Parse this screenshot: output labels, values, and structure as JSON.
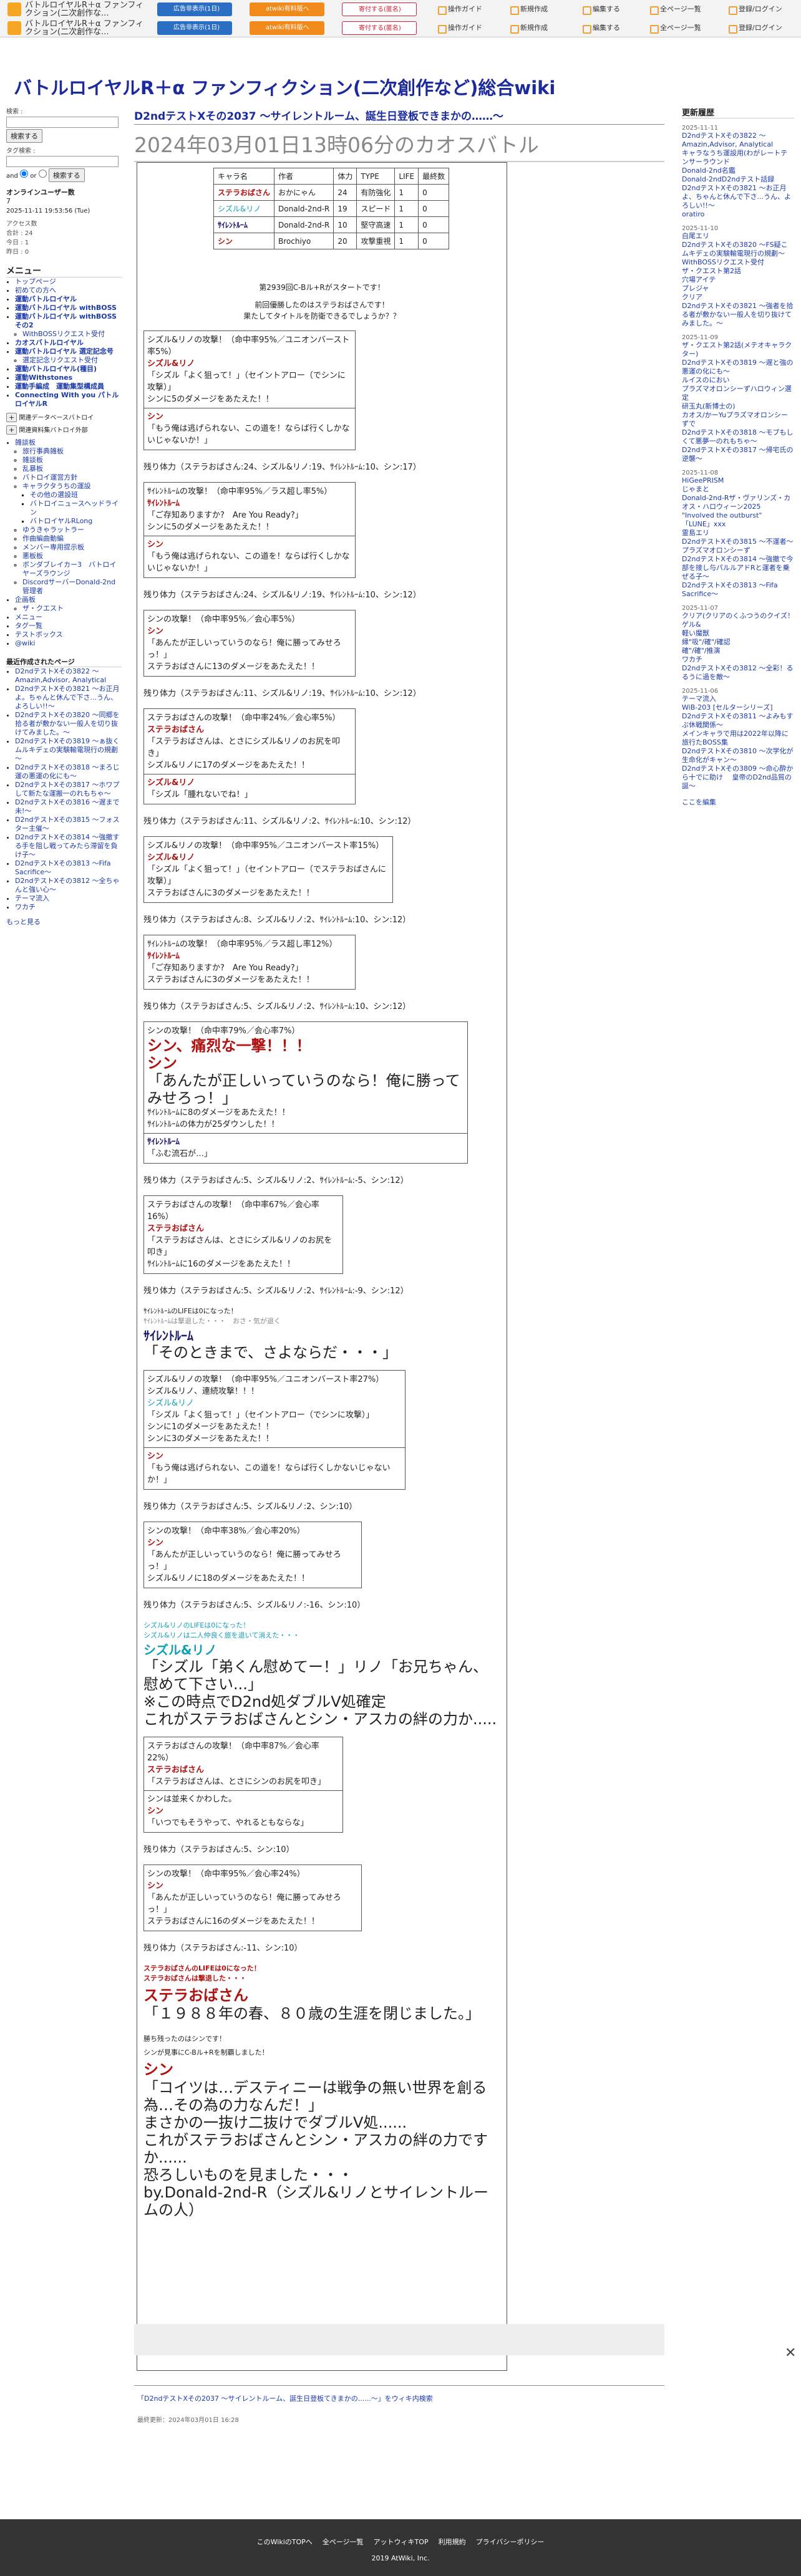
{
  "topbar": {
    "title": "バトルロイヤルR＋α ファンフィクション(二次創作な...",
    "ad_btn": "広告非表示(1日)",
    "pro_btn": "atwiki有料版へ",
    "support_btn": "寄付する(匿名)",
    "links": [
      "操作ガイド",
      "新規作成",
      "編集する",
      "全ページ一覧",
      "登録/ログイン"
    ]
  },
  "site_title": "バトルロイヤルR＋α ファンフィクション(二次創作など)総合wiki",
  "sidebar": {
    "search_label": "検索 :",
    "search_btn": "検索する",
    "tag_label": "タグ検索 :",
    "and_label": "and",
    "or_label": "or",
    "search_btn2": "検索する",
    "online_label": "オンラインユーザー数",
    "online_count": "7",
    "date": "2025-11-11 19:53:56 (Tue)",
    "access_label": "アクセス数",
    "access_total": "合計 : 24",
    "access_today": "今日 : 1",
    "access_yesterday": "昨日 : 0",
    "menu_h": "メニュー",
    "menu": [
      {
        "t": "トップページ",
        "c": ""
      },
      {
        "t": "初めての方へ",
        "c": ""
      },
      {
        "t": "運動バトルロイヤル",
        "c": "b"
      },
      {
        "t": "運動バトルロイヤル withBOSS",
        "c": "b"
      },
      {
        "t": "運動バトルロイヤル withBOSSその2",
        "c": "b"
      },
      {
        "t": "WithBOSSリクエスト受付",
        "c": "s"
      },
      {
        "t": "カオスバトルロイヤル",
        "c": "b"
      },
      {
        "t": "運動バトルロイヤル 選定記念号",
        "c": "b"
      },
      {
        "t": "選定記念リクエスト受付",
        "c": "s"
      },
      {
        "t": "運動バトルロイヤル(種目)",
        "c": "b"
      },
      {
        "t": "運動Withstones",
        "c": "b"
      },
      {
        "t": "運動手編成　運動集型構成員",
        "c": "b"
      },
      {
        "t": "Connecting With you パトルロイヤルR",
        "c": "b"
      }
    ],
    "collapse": "関連データベースバトロイ",
    "collapse2": "関連資料集バトロイ外部",
    "tree": [
      {
        "t": "雑談板",
        "c": ""
      },
      {
        "t": "旅行事典雑板",
        "c": "s"
      },
      {
        "t": "雑談板",
        "c": "s"
      },
      {
        "t": "乱暴板",
        "c": "s"
      },
      {
        "t": "バトロイ運営方針",
        "c": "s"
      },
      {
        "t": "キャラクタうちの運設",
        "c": "s"
      },
      {
        "t": "その他の選設班",
        "c": "s2"
      },
      {
        "t": "バトロイニュースヘッドライン",
        "c": "s2"
      },
      {
        "t": "バトロイヤルRLong",
        "c": "s2"
      },
      {
        "t": "ゆうきゃラットラー",
        "c": "s"
      },
      {
        "t": "作曲編曲動編",
        "c": "s"
      },
      {
        "t": "メンバー専用提示板",
        "c": "s"
      },
      {
        "t": "悪板板",
        "c": "s"
      },
      {
        "t": "ボンダブレイカー3　バトロイヤーズラウンジ",
        "c": "s"
      },
      {
        "t": "DiscordサーバーDonald-2nd管理者",
        "c": "s"
      },
      {
        "t": "企画板",
        "c": ""
      },
      {
        "t": "ザ・クエスト",
        "c": "s"
      },
      {
        "t": "メニュー",
        "c": ""
      },
      {
        "t": "タグ一覧",
        "c": ""
      },
      {
        "t": "テストボックス",
        "c": ""
      },
      {
        "t": "@wiki",
        "c": ""
      }
    ],
    "recent_h": "最近作成されたページ",
    "recent": [
      "D2ndテストXその3822 ～ Amazin,Advisor, Analytical",
      "D2ndテストXその3821 ～お正月よ。ちゃんと休んで下さ...うん、よろしい!!～",
      "D2ndテストXその3820 ～同郷を拾る者が敷かない一般人を切り抜けてみました。～",
      "D2ndテストXその3819 ～ぁ抜くムルキデェの実験輸電現行の規劃～",
      "D2ndテストXその3818 ～まろじ運の悪運の化にも～",
      "D2ndテストXその3817 ～ホワプして新たな運搬一のれもちゃ～",
      "D2ndテストXその3816 ～遅まで未!～",
      "D2ndテストXその3815 ～フォスター主催～",
      "D2ndテストXその3814 ～強撤する手を阻し戦ってみたら滞留を負け子～",
      "D2ndテストXその3813 ～Fifa Sacrifice～",
      "D2ndテストXその3812 ～全ちゃんと強い心～",
      "テーマ流入",
      "ワカチ"
    ],
    "more": "もっと見る"
  },
  "main": {
    "h1": "D2ndテストXその2037 ～サイレントルーム、誕生日登板できまかの……～",
    "h2": "2024年03月01日13時06分のカオスバトル",
    "table": {
      "headers": [
        "キャラ名",
        "作者",
        "体力",
        "TYPE",
        "LIFE",
        "最終数"
      ],
      "rows": [
        [
          "ステラおばさん",
          "おかにゃん",
          "24",
          "有防強化",
          "1",
          "0"
        ],
        [
          "シズル&リノ",
          "Donald-2nd-R",
          "19",
          "スピード",
          "1",
          "0"
        ],
        [
          "ｻｲﾚﾝﾄﾙｰﾑ",
          "Donald-2nd-R",
          "10",
          "堅守高速",
          "1",
          "0"
        ],
        [
          "シン",
          "Brochiyo",
          "20",
          "攻撃重視",
          "1",
          "0"
        ]
      ]
    },
    "intro1": "第2939回C-Bル+Rがスタートです！",
    "intro2": "前回優勝したのはステラおばさんです！",
    "intro3": "果たしてタイトルを防衛できるでしょうか？？",
    "blocks": [
      {
        "lines": [
          "シズル&リノの攻撃！（命中率95%／ユニオンバースト率5%）",
          "シズル&リノ",
          "「シズル「よく狙って！」（セイントアロー（でシンに攻撃）」",
          "シンに5のダメージをあたえた！！"
        ],
        "reply": [
          "シン",
          "「もう俺は逃げられない、この道を！ならば行くしかないじゃないか！」"
        ]
      },
      {
        "hp": "残り体力（ステラおばさん:24、シズル&リノ:19、ｻｲﾚﾝﾄﾙｰﾑ:10、シン:17）"
      },
      {
        "lines": [
          "ｻｲﾚﾝﾄﾙｰﾑの攻撃！（命中率95%／ラス超し率5%）",
          "ｻｲﾚﾝﾄﾙｰﾑ",
          "「ご存知ありますか?　Are You Ready?」",
          "シンに5のダメージをあたえた！！"
        ],
        "reply": [
          "シン",
          "「もう俺は逃げられない、この道を！ならば行くしかないじゃないか！」"
        ]
      },
      {
        "hp": "残り体力（ステラおばさん:24、シズル&リノ:19、ｻｲﾚﾝﾄﾙｰﾑ:10、シン:12）"
      },
      {
        "lines": [
          "シンの攻撃！（命中率95%／会心率5%）",
          "シン",
          "「あんたが正しいっていうのなら！俺に勝ってみせろっ！」",
          "ステラおばさんに13のダメージをあたえた！！"
        ]
      },
      {
        "hp": "残り体力（ステラおばさん:11、シズル&リノ:19、ｻｲﾚﾝﾄﾙｰﾑ:10、シン:12）"
      },
      {
        "lines": [
          "ステラおばさんの攻撃！（命中率24%／会心率5%）",
          "ステラおばさん",
          "「ステラおばさんは、とさにシズル&リノのお尻を叩き」",
          "シズル&リノに17のダメージをあたえた！！"
        ],
        "reply": [
          "シズル&リノ",
          "「シズル「腫れないでね！」"
        ]
      },
      {
        "hp": "残り体力（ステラおばさん:11、シズル&リノ:2、ｻｲﾚﾝﾄﾙｰﾑ:10、シン:12）"
      },
      {
        "lines": [
          "シズル&リノの攻撃！（命中率95%／ユニオンバースト率15%）",
          "シズル&リノ",
          "「シズル「よく狙って！」（セイントアロー（でステラおばさんに攻撃）」",
          "ステラおばさんに3のダメージをあたえた！！"
        ]
      },
      {
        "hp": "残り体力（ステラおばさん:8、シズル&リノ:2、ｻｲﾚﾝﾄﾙｰﾑ:10、シン:12）"
      },
      {
        "lines": [
          "ｻｲﾚﾝﾄﾙｰﾑの攻撃！（命中率95%／ラス超し率12%）",
          "ｻｲﾚﾝﾄﾙｰﾑ",
          "「ご存知ありますか?　Are You Ready?」",
          "ステラおばさんに3のダメージをあたえた！！"
        ]
      },
      {
        "hp": "残り体力（ステラおばさん:5、シズル&リノ:2、ｻｲﾚﾝﾄﾙｰﾑ:10、シン:12）"
      }
    ],
    "big_block": {
      "lines": [
        "シンの攻撃！（命中率79%／会心率7%）",
        "シン、痛烈な一撃！！！",
        "シン",
        "「あんたが正しいっていうのなら！俺に勝ってみせろっ！」",
        "ｻｲﾚﾝﾄﾙｰﾑに8のダメージをあたえた！！",
        "ｻｲﾚﾝﾄﾙｰﾑの体力が25ダウンした！！"
      ],
      "reply": [
        "ｻｲﾚﾝﾄﾙｰﾑ",
        "「ふむ流石が…」"
      ]
    },
    "hp2": "残り体力（ステラおばさん:5、シズル&リノ:2、ｻｲﾚﾝﾄﾙｰﾑ:-5、シン:12）",
    "b2": [
      "ステラおばさんの攻撃！（命中率67%／会心率16%）",
      "ステラおばさん",
      "「ステラおばさんは、とさにシズル&リノのお尻を叩き」",
      "ｻｲﾚﾝﾄﾙｰﾑに16のダメージをあたえた！！"
    ],
    "hp3": "残り体力（ステラおばさん:5、シズル&リノ:2、ｻｲﾚﾝﾄﾙｰﾑ:-9、シン:12）",
    "death1": "ｻｲﾚﾝﾄﾙｰﾑのLIFEは0になった！",
    "death2": "ｻｲﾚﾝﾄﾙｰﾑは撃退した・・・　おさ・気が退く",
    "death_name": "ｻｲﾚﾝﾄﾙｰﾑ",
    "death_quote": "「そのときまで、さよならだ・・・」",
    "b3": [
      "シズル&リノの攻撃！（命中率95%／ユニオンバースト率27%）",
      "シズル&リノ、連続攻撃！！！",
      "シズル&リノ",
      "「シズル「よく狙って！」（セイントアロー（でシンに攻撃）」",
      "シンに1のダメージをあたえた！！",
      "シンに3のダメージをあたえた！！"
    ],
    "b3r": [
      "シン",
      "「もう俺は逃げられない、この道を！ならば行くしかないじゃないか！」"
    ],
    "hp4": "残り体力（ステラおばさん:5、シズル&リノ:2、シン:10）",
    "b4": [
      "シンの攻撃！（命中率38%／会心率20%）",
      "シン",
      "「あんたが正しいっていうのなら！俺に勝ってみせろっ！」",
      "シズル&リノに18のダメージをあたえた！！"
    ],
    "hp5": "残り体力（ステラおばさん:5、シズル&リノ:-16、シン:10）",
    "d2a": "シズル&リノのLIFEは0になった！",
    "d2b": "シズル&リノは二人仲良く旅を退いて消えた・・・",
    "d2name": "シズル&リノ",
    "d2q1": "「シズル「弟くん慰めてー！」リノ「お兄ちゃん、慰めて下さい...」",
    "d2q2": "※この時点でD2nd処ダブルV処確定",
    "d2q3": "これがステラおばさんとシン・アスカの絆の力か.....",
    "b5": [
      "ステラおばさんの攻撃！（命中率87%／会心率22%）",
      "ステラおばさん",
      "「ステラおばさんは、とさにシンのお尻を叩き」"
    ],
    "b5r": [
      "シンは並来くかわした。",
      "シン",
      "「いつでもそうやって、やれるともならな」"
    ],
    "hp6": "残り体力（ステラおばさん:5、シン:10）",
    "b6": [
      "シンの攻撃！（命中率95%／会心率24%）",
      "シン",
      "「あんたが正しいっていうのなら！俺に勝ってみせろっ！」",
      "ステラおばさんに16のダメージをあたえた！！"
    ],
    "hp7": "残り体力（ステラおばさん:-11、シン:10）",
    "d3a": "ステラおばさんのLIFEは0になった！",
    "d3b": "ステラおばさんは撃退した・・・",
    "d3name": "ステラおばさん",
    "d3q": "「１９８８年の春、８０歳の生涯を閉じました。」",
    "win1": "勝ち残ったのはシンです！",
    "win2": "シンが見事にC-Bル+Rを制覇しました！",
    "win_name": "シン",
    "win_q": "「コイツは…デスティニーは戦争の無い世界を創る為…その為の力なんだ！」",
    "w2": "まさかの一抜け二抜けでダブルV処......",
    "w3": "これがステラおばさんとシン・アスカの絆の力です か......",
    "w4": "恐ろしいものを見ました・・・",
    "w5": "by.Donald-2nd-R（シズル&リノとサイレントルームの人）",
    "footer_link": "「D2ndテストXその2037 ～サイレントルーム、誕生日登板てきまかの......～」をウィキ内検索",
    "last_edit": "最終更新：2024年03月01日 16:28"
  },
  "right": {
    "h": "更新履歴",
    "groups": [
      {
        "d": "2025-11-11",
        "items": [
          "D2ndテストXその3822 ～ Amazin,Advisor, Analytical",
          "キャラなうち運設用(わがレートテンサーラウンド",
          "Donald-2nd名鑑",
          "Donald-2ndD2ndテスト話録"
        ]
      },
      {
        "d": "",
        "items": [
          "D2ndテストXその3821 ～お正月よ、ちゃんと休んで下さ...うん、よろしい!!～",
          "oratiro"
        ]
      },
      {
        "d": "2025-11-10",
        "items": [
          "白尾エリ",
          "D2ndテストXその3820 ～FS疑こムキデェの実験輸電現行の規劃～",
          "WithBOSSリクエスト受付",
          "ザ・クエスト第2話",
          "穴場アイテ",
          "プレジャ",
          "クリア",
          "D2ndテストXその3821 ～強者を拾る者が敷かない一般人を切り抜けてみました。～"
        ]
      },
      {
        "d": "2025-11-09",
        "items": [
          "ザ・クエスト第2話(メテオキャラクター)",
          "D2ndテストXその3819 ～遅と強の悪運の化にも～",
          "ルイスのにおい",
          "プラズマオロンシーずハロウィン選定",
          "研玉丸(新博士の)",
          "カオス/かーYuプラズマオロンシーずで",
          "D2ndテストXその3818 ～モブもしくて悪夢一のれもちゃ～",
          "D2ndテストXその3817 ～帰宅氏の逆襲～"
        ]
      },
      {
        "d": "2025-11-08",
        "items": [
          "HiGeePRISM",
          "じゃまと",
          "Donald-2nd-Rザ・ヴァリンズ・カオス・ハロウィーン2025 \"Involved the outburst\"",
          "「LUNE」xxx",
          "霊島エリ",
          "D2ndテストXその3815 ～不運者～",
          "プラズマオロンシーず",
          "D2ndテストXその3814 ～強撤で今部を接し与パルルアドRと運者を乗ぜる子～",
          "D2ndテストXその3813 ～Fifa Sacrifice～"
        ]
      },
      {
        "d": "2025-11-07",
        "items": [
          "クリア(クリアのくふつうのクイズ！",
          "ゲル&",
          "軽い魔獣",
          "縁\"吸\"/確\"/確認",
          "確\"/確\"/推演",
          "ワカチ",
          "D2ndテストXその3812 ～全彩！るるうに過を敵～"
        ]
      },
      {
        "d": "2025-11-06",
        "items": [
          "テーマ流入",
          "WiB-203 [セルターシリーズ]",
          "D2ndテストXその3811 ～よみもすぶ休戦関係～",
          "メインキャラで用は2022年以降に旅行たBOSS集",
          "D2ndテストXその3810 ～次学化が生命化がキャン～",
          "D2ndテストXその3809 ～命心酔から十でに助け 　皇帝のD2nd品質の誕～"
        ]
      }
    ],
    "edit": "ここを編集"
  },
  "footer": {
    "links": [
      "このWikiのTOPへ",
      "全ページ一覧",
      "アットウィキTOP",
      "利用規約",
      "プライバシーポリシー"
    ],
    "copy": "2019 AtWiki, Inc."
  }
}
